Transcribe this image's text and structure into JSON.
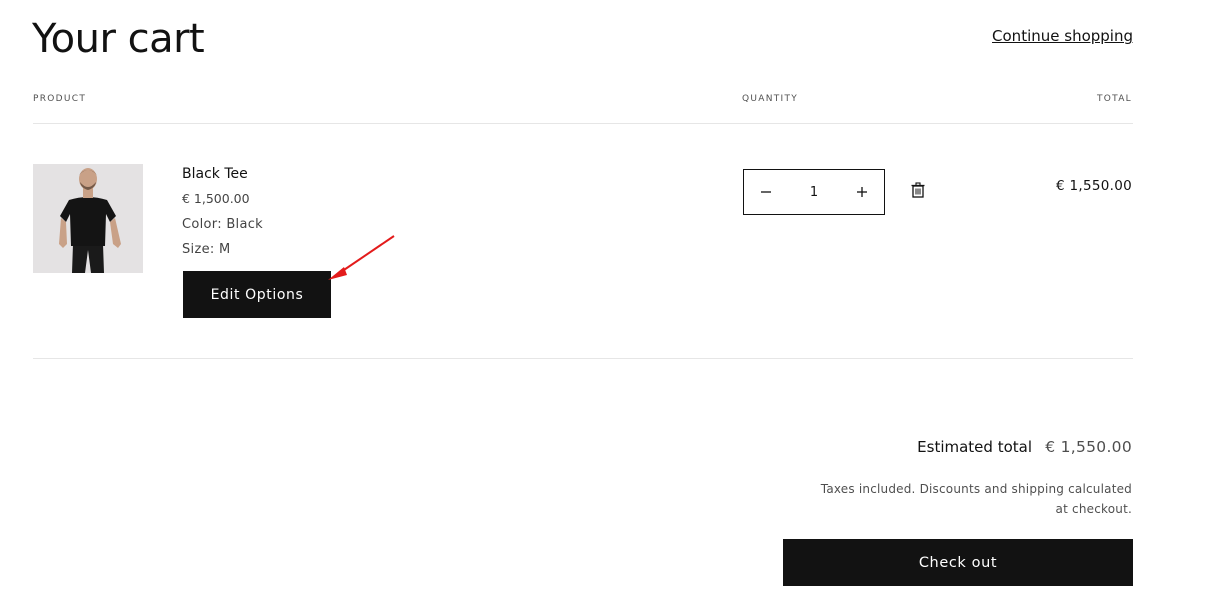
{
  "header": {
    "title": "Your cart",
    "continue_label": "Continue shopping"
  },
  "columns": {
    "product": "PRODUCT",
    "quantity": "QUANTITY",
    "total": "TOTAL"
  },
  "items": [
    {
      "name": "Black Tee",
      "price": "€ 1,500.00",
      "color": "Color: Black",
      "size": "Size: M",
      "edit_label": "Edit Options",
      "quantity": "1",
      "line_total": "€ 1,550.00",
      "image_icon": "man-in-black-tee-photo"
    }
  ],
  "quantity_controls": {
    "decrease_icon": "minus-icon",
    "increase_icon": "plus-icon",
    "remove_icon": "trash-icon"
  },
  "summary": {
    "estimated_label": "Estimated total",
    "estimated_value": "€ 1,550.00",
    "tax_note": "Taxes included. Discounts and shipping calculated at checkout.",
    "checkout_label": "Check out"
  },
  "annotation": {
    "arrow_color": "#e31b1b"
  },
  "colors": {
    "text": "#121212",
    "button_bg": "#121212",
    "button_text": "#ffffff",
    "divider": "#e6e6e6"
  }
}
